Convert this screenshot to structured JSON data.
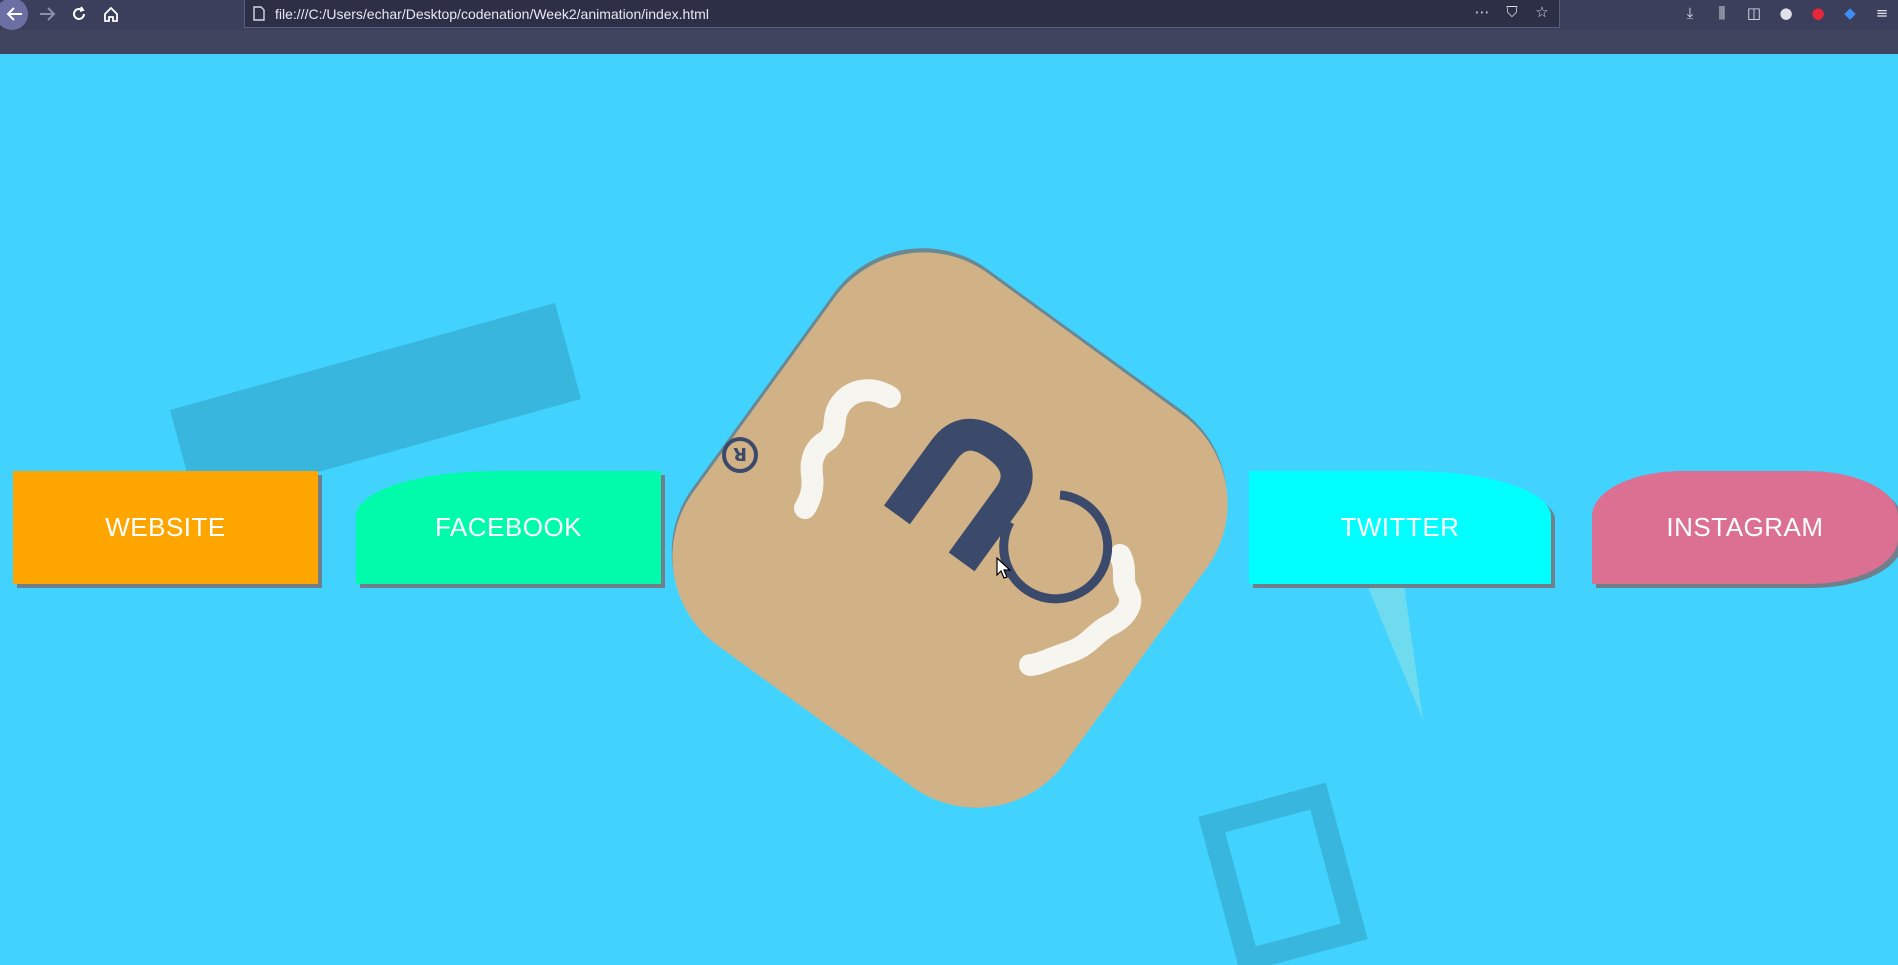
{
  "browser": {
    "url": "file:///C:/Users/echar/Desktop/codenation/Week2/animation/index.html",
    "nav": {
      "back_icon": "arrow-left",
      "forward_icon": "arrow-right",
      "reload_icon": "reload",
      "home_icon": "home"
    },
    "url_tools": {
      "more": "⋯",
      "pocket": "⛉",
      "bookmark": "☆"
    },
    "toolbar_icons": [
      "downloads",
      "library",
      "sidebar",
      "account",
      "blocker",
      "vpn",
      "menu"
    ]
  },
  "page": {
    "background": "#41d3fd",
    "buttons": {
      "website": "WEBSITE",
      "facebook": "FACEBOOK",
      "twitter": "TWITTER",
      "instagram": "INSTAGRAM"
    },
    "colors": {
      "website": "#ffa500",
      "facebook": "#00fbab",
      "twitter": "#00ffff",
      "instagram": "#db7093",
      "logo_tile": "#d1b286",
      "logo_ink": "#3b4a6b"
    },
    "logo": {
      "mark": "registered-mark",
      "letters": "cn"
    }
  }
}
